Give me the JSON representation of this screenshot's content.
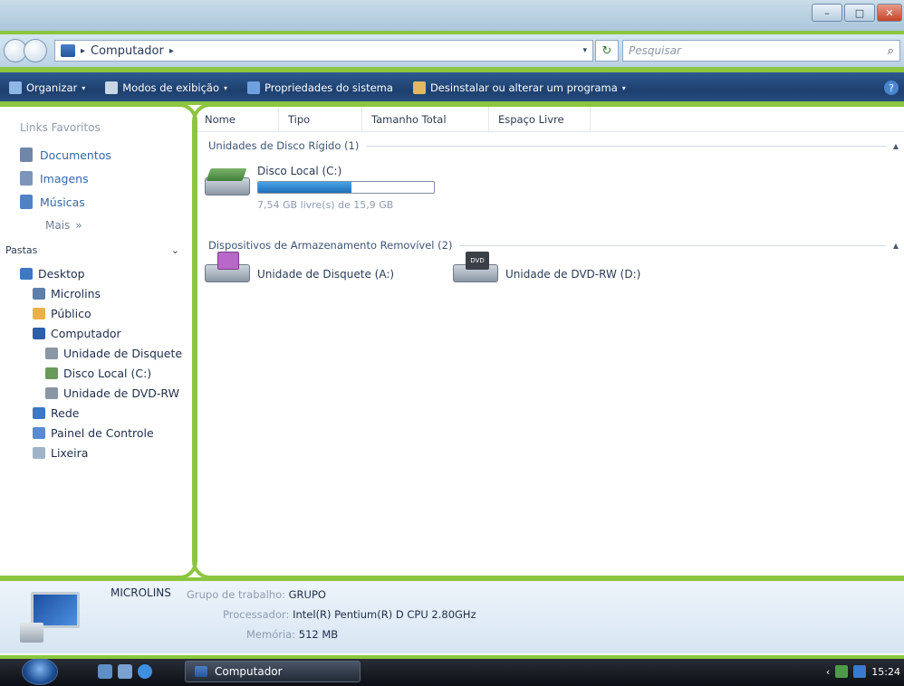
{
  "window": {
    "buttons": {
      "minimize": "–",
      "maximize": "□",
      "close": "✕"
    }
  },
  "address": {
    "path": "Computador",
    "separator": "▸",
    "dropdown": "▾",
    "refresh": "↻",
    "search_placeholder": "Pesquisar",
    "search_icon": "⌕"
  },
  "toolbar": {
    "organize": "Organizar",
    "views": "Modos de exibição",
    "system_properties": "Propriedades do sistema",
    "uninstall": "Desinstalar ou alterar um programa",
    "caret": "▾",
    "help": "?"
  },
  "nav": {
    "favorites_title": "Links Favoritos",
    "favorites": [
      {
        "label": "Documentos",
        "color": "#6f86a8"
      },
      {
        "label": "Imagens",
        "color": "#7b95b8"
      },
      {
        "label": "Músicas",
        "color": "#4f82c4"
      }
    ],
    "more": "Mais",
    "more_arrow": "»",
    "folders_title": "Pastas",
    "folders_chevron": "⌄",
    "tree": [
      {
        "label": "Desktop",
        "level": 0,
        "color": "#3f78c2"
      },
      {
        "label": "Microlins",
        "level": 1,
        "color": "#5d7fa8"
      },
      {
        "label": "Público",
        "level": 1,
        "color": "#e8b24a"
      },
      {
        "label": "Computador",
        "level": 1,
        "color": "#2f5fa6"
      },
      {
        "label": "Unidade de Disquete (A:)",
        "level": 2,
        "color": "#8a96a4"
      },
      {
        "label": "Disco Local (C:)",
        "level": 2,
        "color": "#6a9a5a"
      },
      {
        "label": "Unidade de DVD-RW (D:)",
        "level": 2,
        "color": "#8a96a4"
      },
      {
        "label": "Rede",
        "level": 1,
        "color": "#3f78c2"
      },
      {
        "label": "Painel de Controle",
        "level": 1,
        "color": "#5a8ad0"
      },
      {
        "label": "Lixeira",
        "level": 1,
        "color": "#9fb3c8"
      }
    ]
  },
  "main": {
    "columns": [
      "Nome",
      "Tipo",
      "Tamanho Total",
      "Espaço Livre"
    ],
    "group_hdd": "Unidades de Disco Rígido (1)",
    "group_removable": "Dispositivos de Armazenamento Removível (2)",
    "collapse_icon": "▲",
    "disk_c": {
      "label": "Disco Local (C:)",
      "free_text": "7,54 GB livre(s) de 15,9 GB",
      "used_fraction": 0.53
    },
    "floppy": {
      "label": "Unidade de Disquete (A:)"
    },
    "dvd": {
      "label": "Unidade de DVD-RW (D:)",
      "badge": "DVD"
    }
  },
  "details": {
    "computer_name": "MICROLINS",
    "workgroup_label": "Grupo de trabalho:",
    "workgroup": "GRUPO",
    "processor_label": "Processador:",
    "processor": "Intel(R) Pentium(R) D CPU 2.80GHz",
    "memory_label": "Memória:",
    "memory": "512 MB"
  },
  "taskbar": {
    "window_button": "Computador",
    "tray_chevron": "‹",
    "clock": "15:24"
  }
}
